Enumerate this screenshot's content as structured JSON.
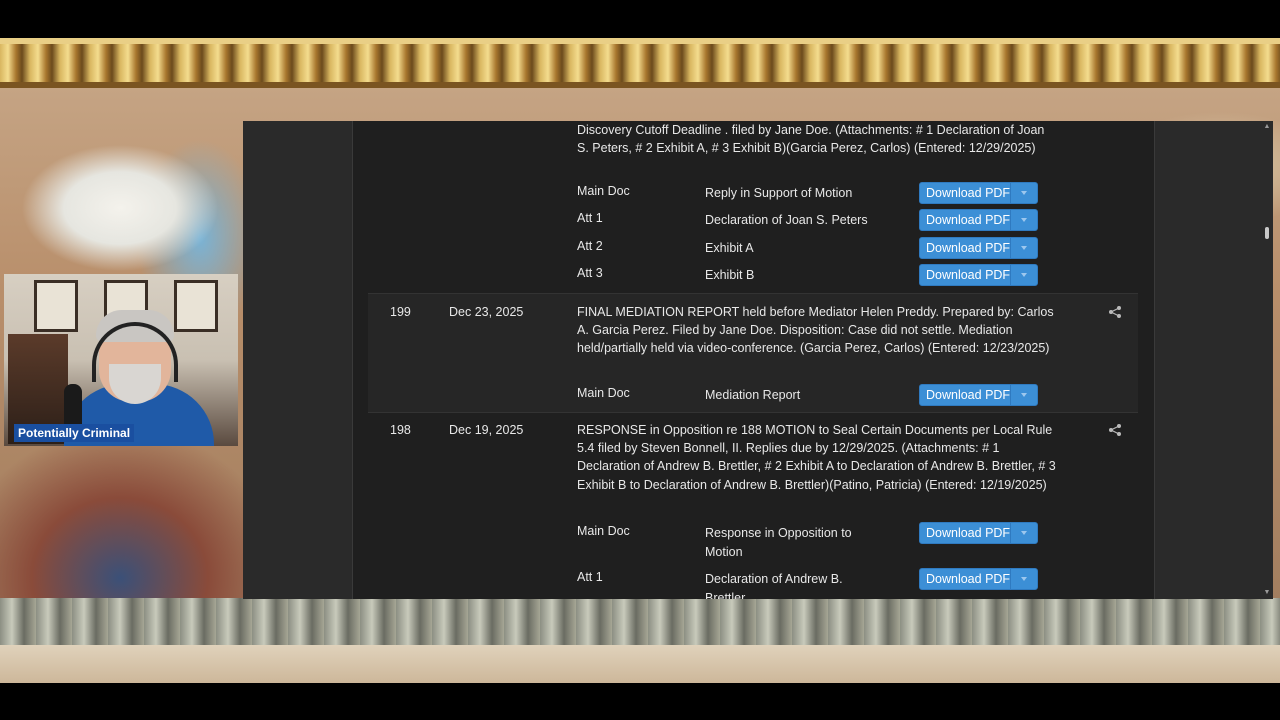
{
  "overlay": {
    "name_tag": "Potentially Criminal"
  },
  "entries": [
    {
      "number": "",
      "date": "",
      "text": "Discovery Cutoff Deadline . filed by Jane Doe. (Attachments: # 1 Declaration of Joan S. Peters, # 2 Exhibit A, # 3 Exhibit B)(Garcia Perez, Carlos) (Entered: 12/29/2025)",
      "documents": [
        {
          "label": "Main Doc",
          "description": "Reply in Support of Motion",
          "button": "Download PDF"
        },
        {
          "label": "Att 1",
          "description": "Declaration of Joan S. Peters",
          "button": "Download PDF"
        },
        {
          "label": "Att 2",
          "description": "Exhibit A",
          "button": "Download PDF"
        },
        {
          "label": "Att 3",
          "description": "Exhibit B",
          "button": "Download PDF"
        }
      ]
    },
    {
      "number": "199",
      "date": "Dec 23, 2025",
      "text": "FINAL MEDIATION REPORT held before Mediator Helen Preddy. Prepared by: Carlos A. Garcia Perez. Filed by Jane Doe. Disposition: Case did not settle. Mediation held/partially held via video-conference. (Garcia Perez, Carlos) (Entered: 12/23/2025)",
      "documents": [
        {
          "label": "Main Doc",
          "description": "Mediation Report",
          "button": "Download PDF"
        }
      ]
    },
    {
      "number": "198",
      "date": "Dec 19, 2025",
      "text": "RESPONSE in Opposition re 188 MOTION to Seal Certain Documents per Local Rule 5.4 filed by Steven Bonnell, II. Replies due by 12/29/2025. (Attachments: # 1 Declaration of Andrew B. Brettler, # 2 Exhibit A to Declaration of Andrew B. Brettler, # 3 Exhibit B to Declaration of Andrew B. Brettler)(Patino, Patricia) (Entered: 12/19/2025)",
      "documents": [
        {
          "label": "Main Doc",
          "description": "Response in Opposition to Motion",
          "button": "Download PDF"
        },
        {
          "label": "Att 1",
          "description": "Declaration of Andrew B. Brettler",
          "button": "Download PDF"
        }
      ]
    }
  ],
  "colors": {
    "accent_button": "#3c8fd6",
    "panel_bg": "#1f1f1f",
    "text": "#e8e8e8"
  },
  "icons": {
    "share": "share-icon",
    "caret": "chevron-down-icon"
  }
}
